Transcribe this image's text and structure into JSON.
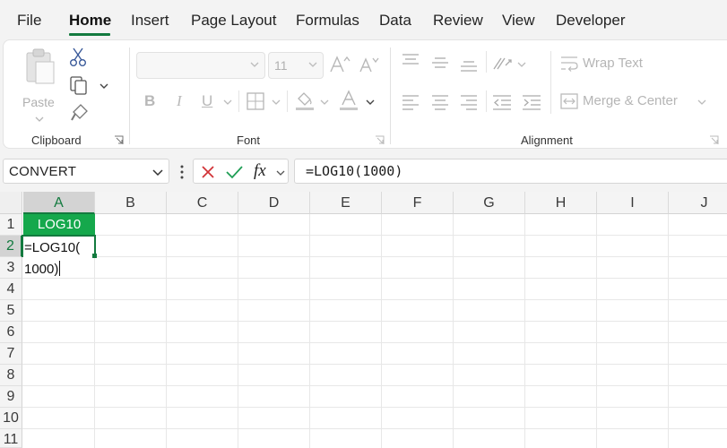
{
  "menu": {
    "tabs": [
      "File",
      "Home",
      "Insert",
      "Page Layout",
      "Formulas",
      "Data",
      "Review",
      "View",
      "Developer"
    ],
    "active_tab": "Home"
  },
  "ribbon": {
    "clipboard": {
      "paste_label": "Paste",
      "group_label": "Clipboard"
    },
    "font": {
      "font_name": "",
      "font_size": "11",
      "group_label": "Font"
    },
    "alignment": {
      "wrap_text_label": "Wrap Text",
      "merge_center_label": "Merge & Center",
      "group_label": "Alignment"
    }
  },
  "formula_bar": {
    "name_box": "CONVERT",
    "fx_label": "fx",
    "formula": "=LOG10(1000)"
  },
  "grid": {
    "columns": [
      "A",
      "B",
      "C",
      "D",
      "E",
      "F",
      "G",
      "H",
      "I",
      "J"
    ],
    "rows": [
      "1",
      "2",
      "3",
      "4",
      "5",
      "6",
      "7",
      "8",
      "9",
      "10",
      "11"
    ],
    "cells": {
      "A1": "LOG10",
      "A2_line1": "=LOG10(",
      "A2_line2": "1000)"
    }
  },
  "colors": {
    "accent": "#137a3f",
    "header_fill": "#15a84c"
  }
}
